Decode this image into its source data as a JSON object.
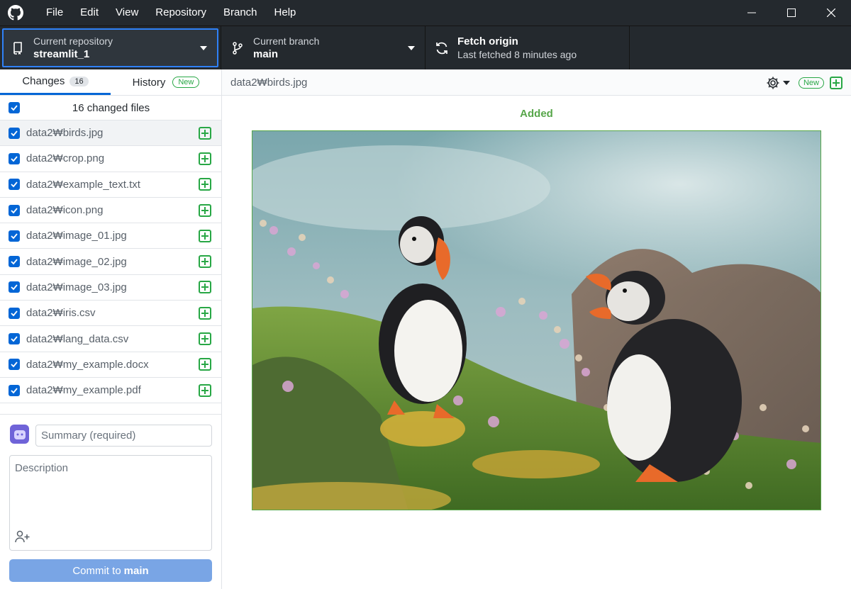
{
  "menu": [
    "File",
    "Edit",
    "View",
    "Repository",
    "Branch",
    "Help"
  ],
  "toolbar": {
    "repo_label": "Current repository",
    "repo_value": "streamlit_1",
    "branch_label": "Current branch",
    "branch_value": "main",
    "fetch_label": "Fetch origin",
    "fetch_sub": "Last fetched 8 minutes ago"
  },
  "tabs": {
    "changes_label": "Changes",
    "changes_count": "16",
    "history_label": "History",
    "history_badge": "New"
  },
  "files": {
    "header": "16 changed files",
    "items": [
      "data2₩birds.jpg",
      "data2₩crop.png",
      "data2₩example_text.txt",
      "data2₩icon.png",
      "data2₩image_01.jpg",
      "data2₩image_02.jpg",
      "data2₩image_03.jpg",
      "data2₩iris.csv",
      "data2₩lang_data.csv",
      "data2₩my_example.docx",
      "data2₩my_example.pdf"
    ]
  },
  "commit": {
    "summary_placeholder": "Summary (required)",
    "description_placeholder": "Description",
    "button_prefix": "Commit to",
    "button_branch": "main"
  },
  "diff": {
    "path": "data2₩birds.jpg",
    "badge": "New",
    "status": "Added"
  },
  "colors": {
    "accent": "#0366d6",
    "added": "#28a745",
    "dark_bg": "#24292e"
  }
}
